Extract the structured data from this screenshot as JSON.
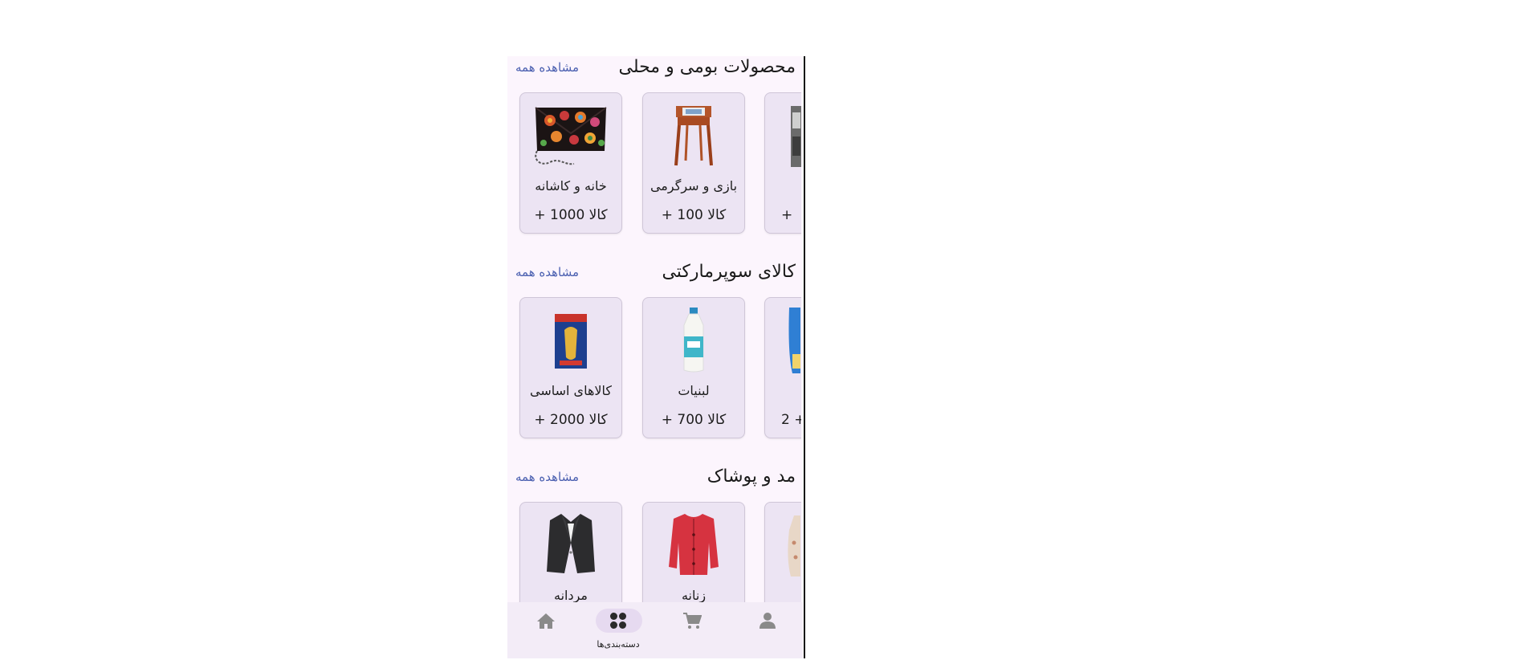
{
  "sections": [
    {
      "title": "محصولات بومی و محلی",
      "see_all": "مشاهده همه",
      "cards": [
        {
          "name": "خانه و کاشانه",
          "count": "کالا 1000 +",
          "icon": "embroidered-bag-image"
        },
        {
          "name": "بازی و سرگرمی",
          "count": "کالا 100 +",
          "icon": "wooden-stool-image"
        },
        {
          "name": "",
          "count": "+",
          "icon": "partial-product-image"
        }
      ]
    },
    {
      "title": "کالای سوپرمارکتی",
      "see_all": "مشاهده همه",
      "cards": [
        {
          "name": "کالاهای اساسی",
          "count": "کالا 2000 +",
          "icon": "pasta-pack-image"
        },
        {
          "name": "لبنیات",
          "count": "کالا 700 +",
          "icon": "milk-bottle-image"
        },
        {
          "name": "",
          "count": "+ 2",
          "icon": "partial-product-image"
        }
      ]
    },
    {
      "title": "مد و پوشاک",
      "see_all": "مشاهده همه",
      "cards": [
        {
          "name": "مردانه",
          "count": "",
          "icon": "blazer-image"
        },
        {
          "name": "زنانه",
          "count": "",
          "icon": "red-cardigan-image"
        },
        {
          "name": "",
          "count": "",
          "icon": "partial-product-image"
        }
      ]
    }
  ],
  "bottom_nav": {
    "items": [
      {
        "key": "home",
        "label": "",
        "icon": "home-icon"
      },
      {
        "key": "categories",
        "label": "دسته‌بندی‌ها",
        "icon": "grid-icon",
        "active": true
      },
      {
        "key": "cart",
        "label": "",
        "icon": "cart-icon"
      },
      {
        "key": "profile",
        "label": "",
        "icon": "person-icon"
      }
    ]
  },
  "colors": {
    "background": "#fcf5fd",
    "card": "#ece4f3",
    "link": "#4a5fb0",
    "nav": "#f3ecf7",
    "nav_active_pill": "#e6daf0",
    "nav_icon": "#8a8a8a"
  }
}
